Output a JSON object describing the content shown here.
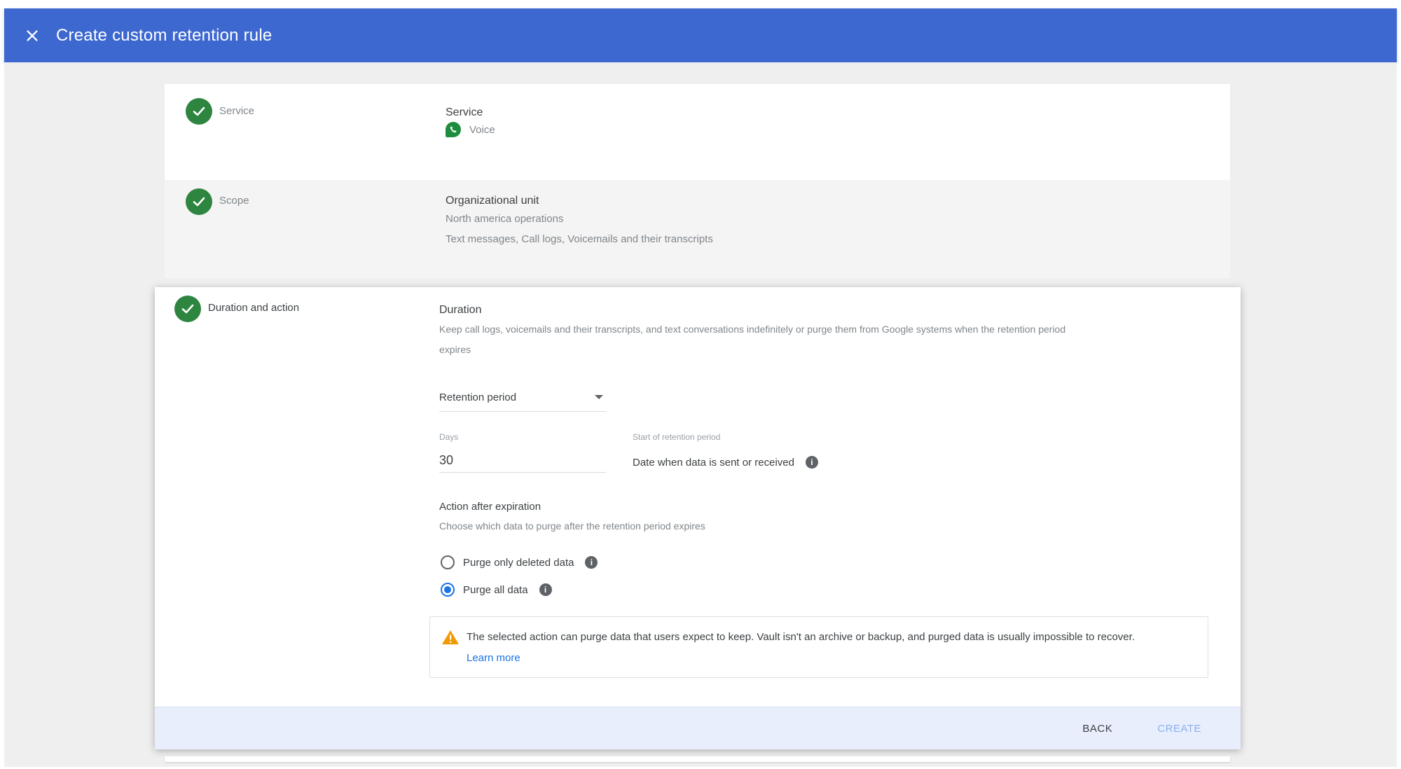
{
  "header": {
    "title": "Create custom retention rule",
    "close_icon": "close-icon"
  },
  "steps": {
    "service": {
      "label": "Service",
      "field_title": "Service",
      "value": "Voice",
      "icon": "voice-icon"
    },
    "scope": {
      "label": "Scope",
      "field_title": "Organizational unit",
      "value": "North america operations",
      "detail": "Text messages, Call logs, Voicemails and their transcripts"
    },
    "duration": {
      "label": "Duration and action",
      "title": "Duration",
      "description_line1": "Keep call logs, voicemails and their transcripts, and text conversations indefinitely or purge them from Google systems when the retention period",
      "description_line2": "expires",
      "select_value": "Retention period",
      "days_label": "Days",
      "days_value": "30",
      "start_label": "Start of retention period",
      "start_value": "Date when data is sent or received",
      "action_title": "Action after expiration",
      "action_description": "Choose which data to purge after the retention period expires",
      "options": [
        {
          "label": "Purge only deleted data",
          "checked": false
        },
        {
          "label": "Purge all data",
          "checked": true
        }
      ],
      "warning_text": "The selected action can purge data that users expect to keep. Vault isn't an archive or backup, and purged data is usually impossible to recover.",
      "learn_more": "Learn more"
    }
  },
  "footer": {
    "back_label": "BACK",
    "create_label": "CREATE"
  },
  "colors": {
    "header": "#3d68d0",
    "check": "#2e8540",
    "accent": "#1a73e8",
    "warning": "#f29900"
  }
}
